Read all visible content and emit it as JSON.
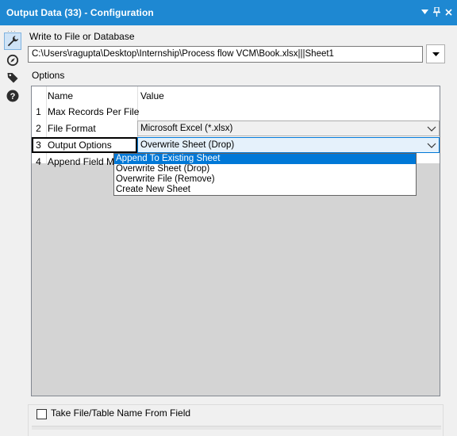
{
  "window": {
    "title": "Output Data (33) - Configuration",
    "controls": [
      "chevron-down-icon",
      "pin-icon",
      "close-icon"
    ]
  },
  "sidebar": {
    "icons": [
      "wrench-icon",
      "compass-icon",
      "tag-icon",
      "help-icon"
    ],
    "active": "wrench-icon"
  },
  "write": {
    "label": "Write to File or Database",
    "path": "C:\\Users\\ragupta\\Desktop\\Internship\\Process flow VCM\\Book.xlsx|||Sheet1"
  },
  "options": {
    "label": "Options",
    "columns": {
      "name": "Name",
      "value": "Value"
    },
    "rows": [
      {
        "num": "1",
        "name": "Max Records Per File",
        "value": ""
      },
      {
        "num": "2",
        "name": "File Format",
        "value": "Microsoft Excel (*.xlsx)"
      },
      {
        "num": "3",
        "name": "Output Options",
        "value": "Overwrite Sheet (Drop)"
      },
      {
        "num": "4",
        "name": "Append Field Map",
        "value": ""
      }
    ],
    "dropdown": {
      "items": [
        "Append To Existing Sheet",
        "Overwrite Sheet (Drop)",
        "Overwrite File (Remove)",
        "Create New Sheet"
      ],
      "highlighted": "Append To Existing Sheet"
    }
  },
  "take_name": {
    "label": "Take File/Table Name From Field",
    "checked": false
  },
  "colors": {
    "accent": "#1e88d2",
    "highlight": "#0078d7"
  }
}
